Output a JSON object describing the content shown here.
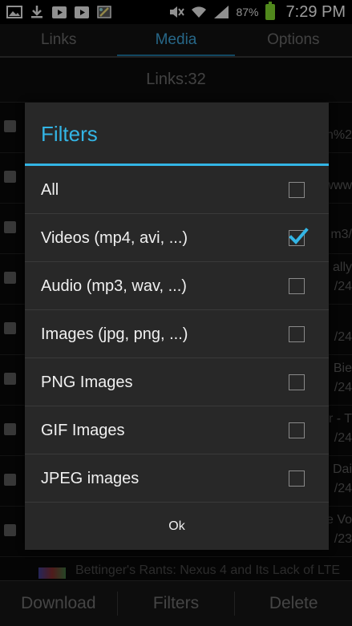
{
  "statusbar": {
    "battery_percent": "87%",
    "time": "7:29 PM",
    "left_icons": [
      "image-icon",
      "download-icon",
      "youtube-icon",
      "youtube-icon",
      "image-edit-icon"
    ],
    "right_icons": [
      "mute-icon",
      "wifi-icon",
      "signal-icon",
      "battery-icon"
    ]
  },
  "tabs": [
    {
      "label": "Links",
      "active": false
    },
    {
      "label": "Media",
      "active": true
    },
    {
      "label": "Options",
      "active": false
    }
  ],
  "links_count": "Links:32",
  "background_rows": [
    {
      "text": "n%2"
    },
    {
      "text": "www"
    },
    {
      "text": "m3/"
    },
    {
      "text": "ally",
      "sub": "/24"
    },
    {
      "text": "/24"
    },
    {
      "text": "Bie",
      "sub": "/24"
    },
    {
      "text": "r - T",
      "sub": "/24"
    },
    {
      "text": "Dai",
      "sub": "/24"
    },
    {
      "text": "e Vo",
      "sub": "/23"
    }
  ],
  "background_title": "Bettinger's Rants: Nexus 4 and Its Lack of LTE",
  "dialog": {
    "title": "Filters",
    "options": [
      {
        "label": "All",
        "checked": false
      },
      {
        "label": "Videos (mp4, avi, ...)",
        "checked": true
      },
      {
        "label": "Audio (mp3, wav, ...)",
        "checked": false
      },
      {
        "label": "Images (jpg, png, ...)",
        "checked": false
      },
      {
        "label": "PNG Images",
        "checked": false
      },
      {
        "label": "GIF Images",
        "checked": false
      },
      {
        "label": "JPEG images",
        "checked": false
      }
    ],
    "ok_label": "Ok"
  },
  "bottombar": {
    "download_label": "Download",
    "filters_label": "Filters",
    "delete_label": "Delete"
  },
  "colors": {
    "accent": "#33b5e5",
    "tab_active": "#3c9fd1",
    "battery": "#7bd12c"
  }
}
